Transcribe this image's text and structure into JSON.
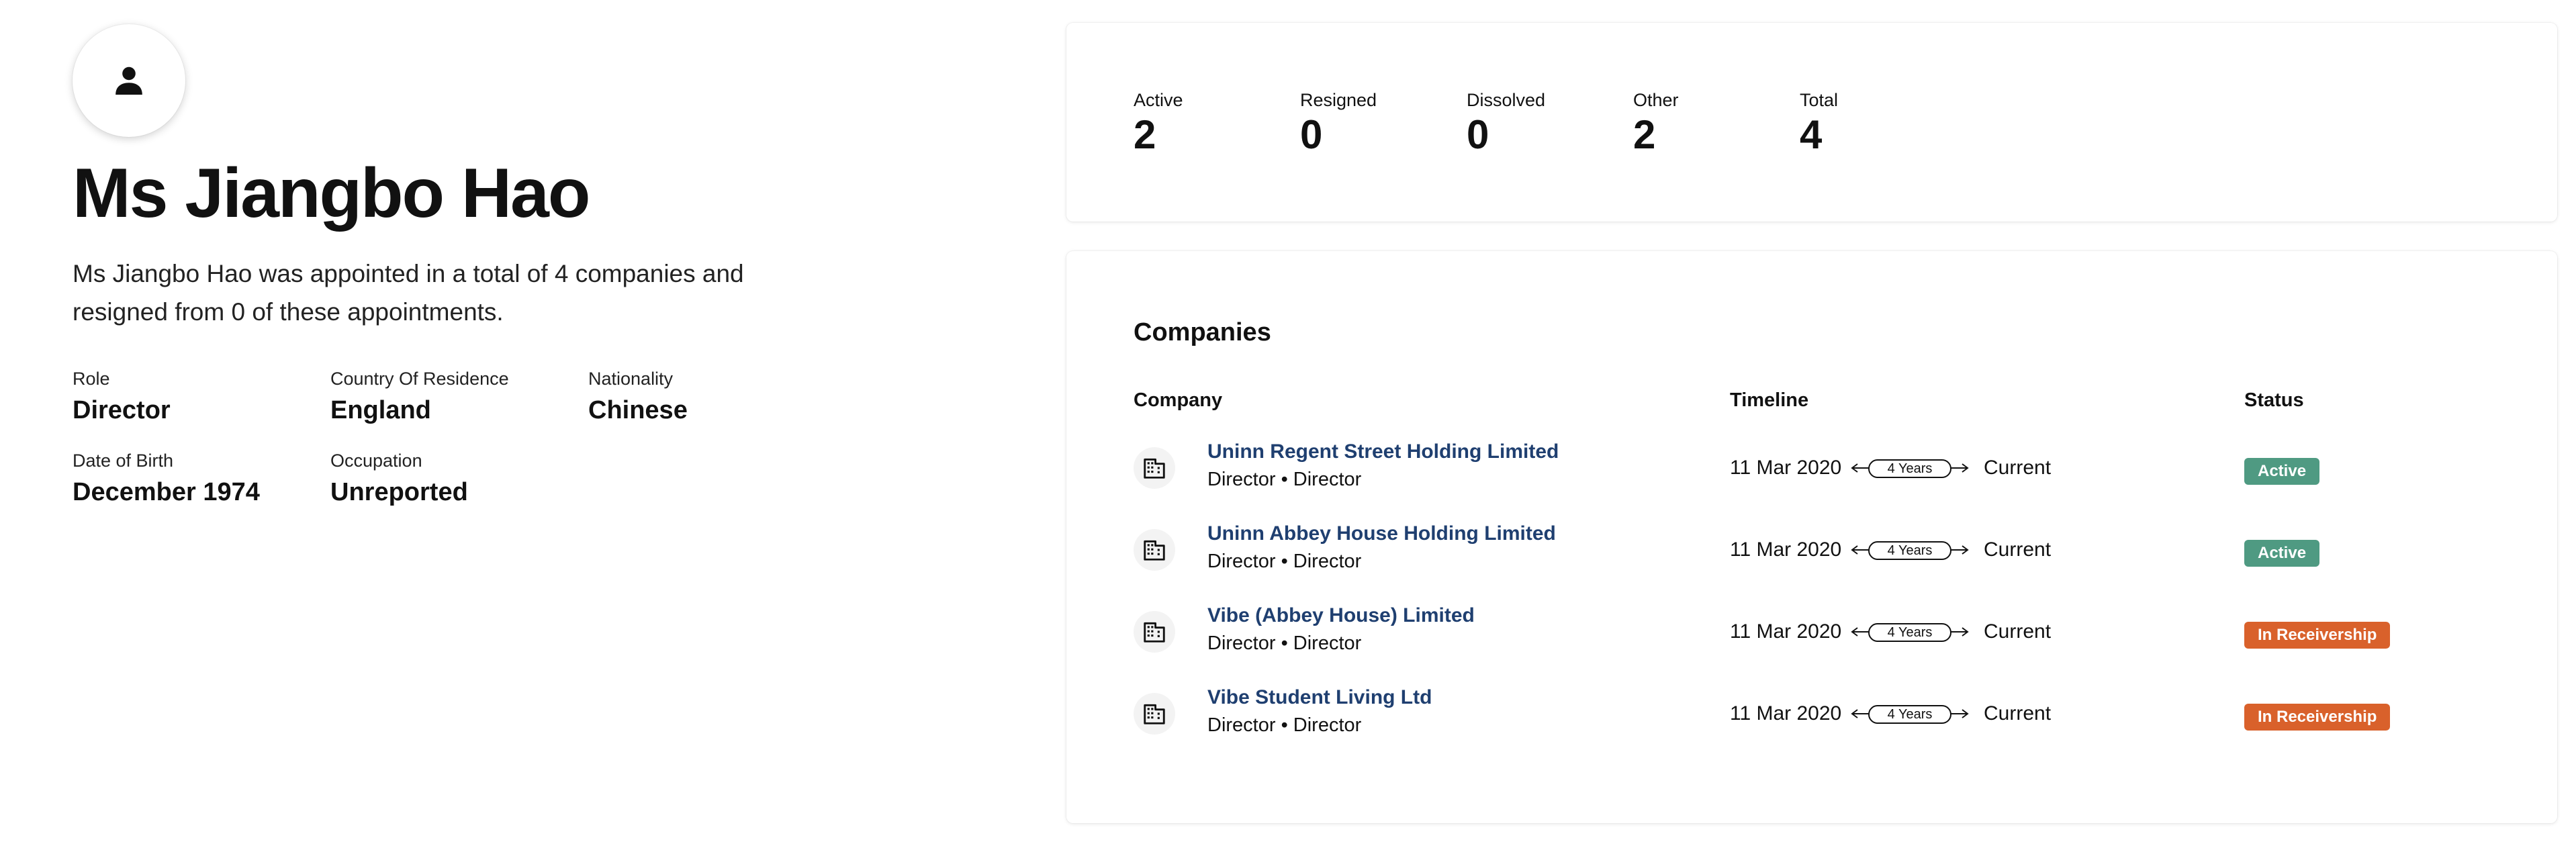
{
  "profile": {
    "name": "Ms Jiangbo Hao",
    "summary": "Ms Jiangbo Hao was appointed in a total of 4 companies and resigned from 0 of these appointments.",
    "facts": [
      {
        "label": "Role",
        "value": "Director"
      },
      {
        "label": "Country Of Residence",
        "value": "England"
      },
      {
        "label": "Nationality",
        "value": "Chinese"
      },
      {
        "label": "Date of Birth",
        "value": "December 1974"
      },
      {
        "label": "Occupation",
        "value": "Unreported"
      }
    ]
  },
  "stats": [
    {
      "label": "Active",
      "value": "2"
    },
    {
      "label": "Resigned",
      "value": "0"
    },
    {
      "label": "Dissolved",
      "value": "0"
    },
    {
      "label": "Other",
      "value": "2"
    },
    {
      "label": "Total",
      "value": "4"
    }
  ],
  "companies": {
    "title": "Companies",
    "columns": {
      "company": "Company",
      "timeline": "Timeline",
      "status": "Status"
    },
    "rows": [
      {
        "name": "Uninn Regent Street Holding Limited",
        "role": "Director • Director",
        "start": "11 Mar 2020",
        "duration": "4 Years",
        "end": "Current",
        "status": "Active",
        "status_color": "#4f9a82"
      },
      {
        "name": "Uninn Abbey House Holding Limited",
        "role": "Director • Director",
        "start": "11 Mar 2020",
        "duration": "4 Years",
        "end": "Current",
        "status": "Active",
        "status_color": "#4f9a82"
      },
      {
        "name": "Vibe (Abbey House) Limited",
        "role": "Director • Director",
        "start": "11 Mar 2020",
        "duration": "4 Years",
        "end": "Current",
        "status": "In Receivership",
        "status_color": "#d9612b"
      },
      {
        "name": "Vibe Student Living Ltd",
        "role": "Director • Director",
        "start": "11 Mar 2020",
        "duration": "4 Years",
        "end": "Current",
        "status": "In Receivership",
        "status_color": "#d9612b"
      }
    ]
  },
  "icons": {
    "avatar": "person-icon",
    "company": "building-icon"
  }
}
